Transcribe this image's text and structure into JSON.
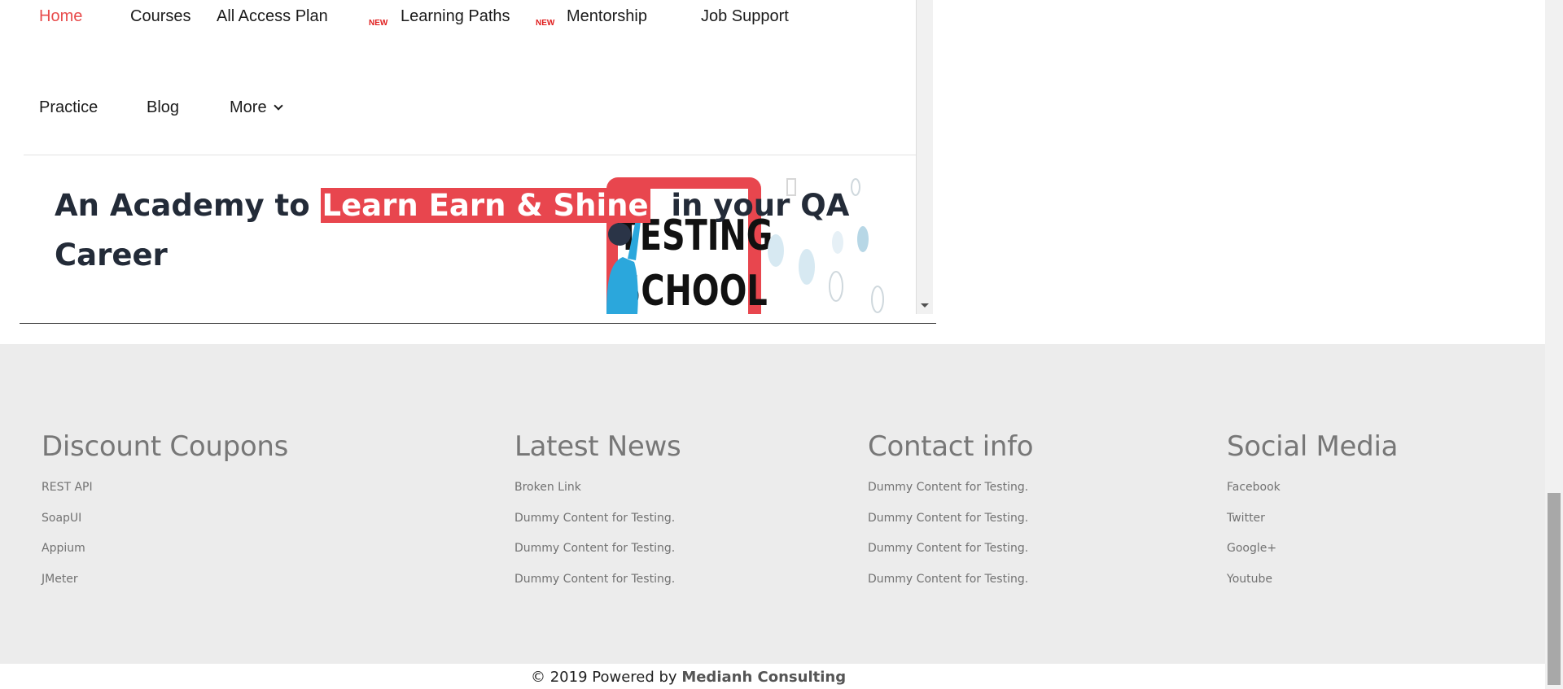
{
  "nav": {
    "items": [
      {
        "label": "Home"
      },
      {
        "label": "Courses"
      },
      {
        "label": "All Access Plan",
        "badge": "NEW"
      },
      {
        "label": "Learning Paths",
        "badge": "NEW"
      },
      {
        "label": "Mentorship"
      },
      {
        "label": "Job Support"
      },
      {
        "label": "Practice"
      },
      {
        "label": "Blog"
      },
      {
        "label": "More"
      }
    ]
  },
  "hero": {
    "title_prefix": "An Academy to ",
    "title_highlight": "Learn Earn & Shine",
    "title_suffix": "  in your QA",
    "title_line2": "Career",
    "image_text_1": "TESTING",
    "image_text_2": "SCHOOL"
  },
  "footer": {
    "columns": [
      {
        "heading": "Discount Coupons",
        "links": [
          "REST API",
          "SoapUI",
          "Appium",
          "JMeter"
        ]
      },
      {
        "heading": "Latest News",
        "links": [
          "Broken Link",
          "Dummy Content for Testing.",
          "Dummy Content for Testing.",
          "Dummy Content for Testing."
        ]
      },
      {
        "heading": "Contact info",
        "links": [
          "Dummy Content for Testing.",
          "Dummy Content for Testing.",
          "Dummy Content for Testing.",
          "Dummy Content for Testing."
        ]
      },
      {
        "heading": "Social Media",
        "links": [
          "Facebook",
          "Twitter",
          "Google+",
          "Youtube"
        ]
      }
    ],
    "copyright_prefix": "© 2019 Powered by ",
    "copyright_brand": "Medianh Consulting"
  },
  "colors": {
    "accent": "#e84c4c",
    "hero_text": "#232b38",
    "footer_bg": "#ececec",
    "footer_text": "#777777"
  }
}
